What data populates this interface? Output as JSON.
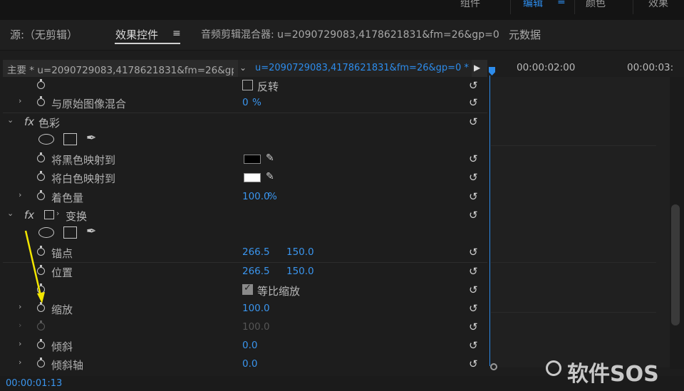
{
  "workspaces": {
    "items": [
      {
        "label": "组件",
        "active": false
      },
      {
        "label": "编辑",
        "active": true
      },
      {
        "label": "颜色",
        "active": false
      },
      {
        "label": "效果",
        "active": false
      }
    ],
    "menu_icon": "hamburger-icon"
  },
  "panel_tabs": {
    "source": "源:（无剪辑）",
    "effect_controls": "效果控件",
    "audio_mixer": "音频剪辑混合器: u=2090729083,4178621831&fm=26&gp=0",
    "metadata": "元数据"
  },
  "sequence_header": {
    "master": "主要 * u=2090729083,4178621831&fm=26&gp=0...",
    "clip": "u=2090729083,4178621831&fm=26&gp=0 * u..."
  },
  "timeline": {
    "timecodes": [
      "00:00:02:00",
      "00:00:03:"
    ]
  },
  "rows": {
    "invert": {
      "label": "反转"
    },
    "blend_original": {
      "name": "与原始图像混合",
      "value": "0",
      "unit": "%"
    },
    "tint_effect": {
      "fx": "fx",
      "name": "色彩"
    },
    "map_black": {
      "name": "将黑色映射到",
      "color": "#000000"
    },
    "map_white": {
      "name": "将白色映射到",
      "color": "#ffffff"
    },
    "tint_amount": {
      "name": "着色量",
      "value": "100.0",
      "unit": "%"
    },
    "transform_effect": {
      "fx": "fx",
      "name": "变换"
    },
    "anchor": {
      "name": "锚点",
      "x": "266.5",
      "y": "150.0"
    },
    "position": {
      "name": "位置",
      "x": "266.5",
      "y": "150.0"
    },
    "uniform_scale": {
      "label": "等比缩放",
      "checked": true
    },
    "scale": {
      "name": "缩放",
      "value": "100.0"
    },
    "scale_width": {
      "value": "100.0"
    },
    "skew": {
      "name": "倾斜",
      "value": "0.0"
    },
    "skew_axis": {
      "name": "倾斜轴",
      "value": "0.0"
    }
  },
  "footer": {
    "current_time": "00:00:01:13"
  },
  "watermark": "软件SOS",
  "colors": {
    "accent": "#2d8ceb",
    "annotation_arrow": "#f2e600"
  }
}
